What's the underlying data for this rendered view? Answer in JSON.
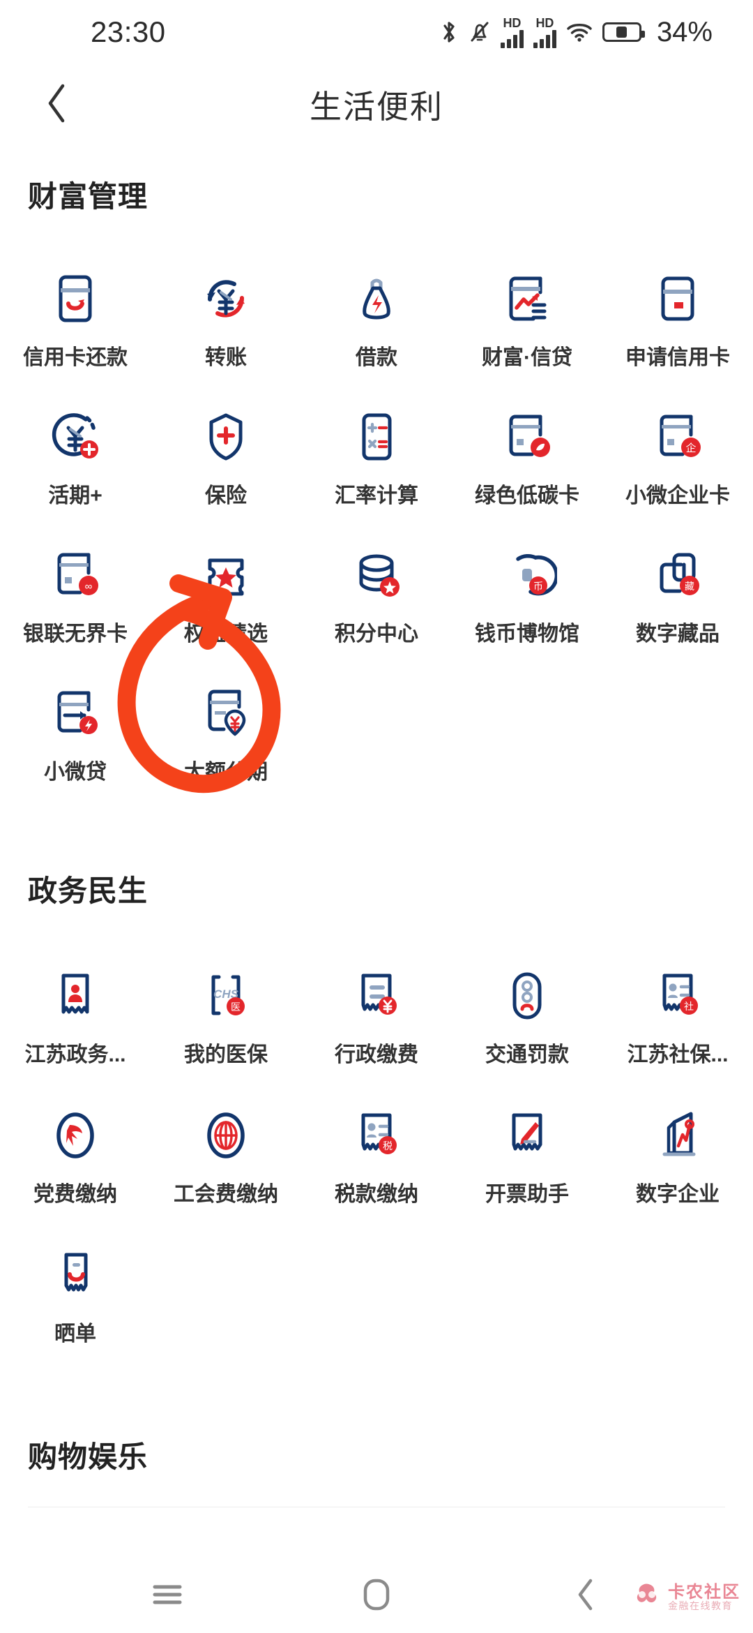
{
  "statusbar": {
    "time": "23:30",
    "battery_percent": "34%",
    "icons": [
      "bluetooth-icon",
      "silent-bell-icon",
      "hd-signal-icon",
      "hd-signal-icon-2",
      "wifi-icon",
      "battery-icon"
    ]
  },
  "appbar": {
    "title": "生活便利",
    "back_icon": "chevron-left-icon"
  },
  "sections": [
    {
      "title": "财富管理",
      "items": [
        {
          "label": "信用卡还款",
          "icon": "credit-card-repay-icon"
        },
        {
          "label": "转账",
          "icon": "transfer-yuan-icon"
        },
        {
          "label": "借款",
          "icon": "loan-bag-icon"
        },
        {
          "label": "财富·信贷",
          "icon": "wealth-credit-icon"
        },
        {
          "label": "申请信用卡",
          "icon": "apply-credit-card-icon"
        },
        {
          "label": "活期+",
          "icon": "current-plus-icon"
        },
        {
          "label": "保险",
          "icon": "insurance-shield-icon"
        },
        {
          "label": "汇率计算",
          "icon": "exchange-calculator-icon"
        },
        {
          "label": "绿色低碳卡",
          "icon": "green-card-icon"
        },
        {
          "label": "小微企业卡",
          "icon": "sme-card-icon"
        },
        {
          "label": "银联无界卡",
          "icon": "unionpay-card-icon"
        },
        {
          "label": "权益精选",
          "icon": "benefits-ticket-icon"
        },
        {
          "label": "积分中心",
          "icon": "points-center-icon"
        },
        {
          "label": "钱币博物馆",
          "icon": "coin-museum-icon"
        },
        {
          "label": "数字藏品",
          "icon": "digital-collection-icon"
        },
        {
          "label": "小微贷",
          "icon": "micro-loan-icon"
        },
        {
          "label": "大额分期",
          "icon": "installment-icon"
        }
      ]
    },
    {
      "title": "政务民生",
      "items": [
        {
          "label": "江苏政务...",
          "icon": "jiangsu-gov-icon"
        },
        {
          "label": "我的医保",
          "icon": "medical-insurance-icon"
        },
        {
          "label": "行政缴费",
          "icon": "admin-fee-icon"
        },
        {
          "label": "交通罚款",
          "icon": "traffic-fine-icon"
        },
        {
          "label": "江苏社保...",
          "icon": "jiangsu-social-icon"
        },
        {
          "label": "党费缴纳",
          "icon": "party-fee-icon"
        },
        {
          "label": "工会费缴纳",
          "icon": "union-fee-icon"
        },
        {
          "label": "税款缴纳",
          "icon": "tax-payment-icon"
        },
        {
          "label": "开票助手",
          "icon": "invoice-helper-icon"
        },
        {
          "label": "数字企业",
          "icon": "digital-enterprise-icon"
        },
        {
          "label": "晒单",
          "icon": "share-order-icon"
        }
      ]
    },
    {
      "title": "购物娱乐",
      "items": []
    }
  ],
  "annotation": {
    "shape": "hand-drawn-circle-arrow",
    "color": "#f4421a",
    "targets": "权益精选"
  },
  "navbar": {
    "buttons": [
      {
        "name": "menu-icon",
        "label": "menu"
      },
      {
        "name": "home-icon",
        "label": "home"
      },
      {
        "name": "back-icon",
        "label": "back"
      }
    ]
  },
  "watermark": {
    "main": "卡农社区",
    "sub": "金融在线教育",
    "color": "#e8808f"
  },
  "colors": {
    "navy": "#12356b",
    "red": "#e3262b",
    "steel": "#8fa4c0",
    "accent_annotation": "#f4421a"
  }
}
